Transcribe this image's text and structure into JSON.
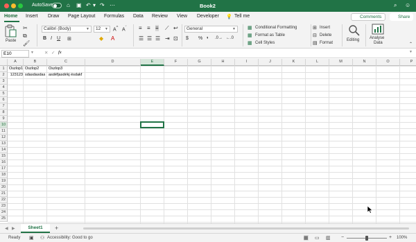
{
  "titlebar": {
    "autosave_label": "AutoSave",
    "doc_title": "Book2",
    "accent": "#217346"
  },
  "menu": {
    "tabs": [
      "Home",
      "Insert",
      "Draw",
      "Page Layout",
      "Formulas",
      "Data",
      "Review",
      "View",
      "Developer"
    ],
    "tell_me": "Tell me",
    "comments": "Comments",
    "share": "Share"
  },
  "ribbon": {
    "paste": "Paste",
    "font_name": "Calibri (Body)",
    "font_size": "12",
    "number_format": "General",
    "conditional_formatting": "Conditional Formatting",
    "format_as_table": "Format as Table",
    "cell_styles": "Cell Styles",
    "insert": "Insert",
    "delete": "Delete",
    "format": "Format",
    "editing": "Editing",
    "analyse_data_1": "Analyse",
    "analyse_data_2": "Data"
  },
  "formula_bar": {
    "name_box": "E10",
    "fx": "fx",
    "content": ""
  },
  "sheet": {
    "columns": [
      "A",
      "B",
      "C",
      "D",
      "E",
      "F",
      "G",
      "H",
      "I",
      "J",
      "K",
      "L",
      "M",
      "N",
      "O",
      "P"
    ],
    "rows": [
      "1",
      "2",
      "3",
      "4",
      "5",
      "6",
      "7",
      "8",
      "9",
      "10",
      "11",
      "12",
      "13",
      "14",
      "15",
      "16",
      "17",
      "18",
      "19",
      "20",
      "21",
      "22",
      "23",
      "24",
      "25"
    ],
    "cells": {
      "A1": "Oszlop1",
      "B1": "Oszlop2",
      "C1": "Oszlop3",
      "A2": "123123",
      "B2": "sdasdasdas",
      "C2": "asdéfjasdékj ésdakf"
    },
    "selected_cell": "E10"
  },
  "tabs": {
    "sheet_name": "Sheet1"
  },
  "status": {
    "ready": "Ready",
    "accessibility": "Accessibility: Good to go",
    "zoom": "100%"
  }
}
